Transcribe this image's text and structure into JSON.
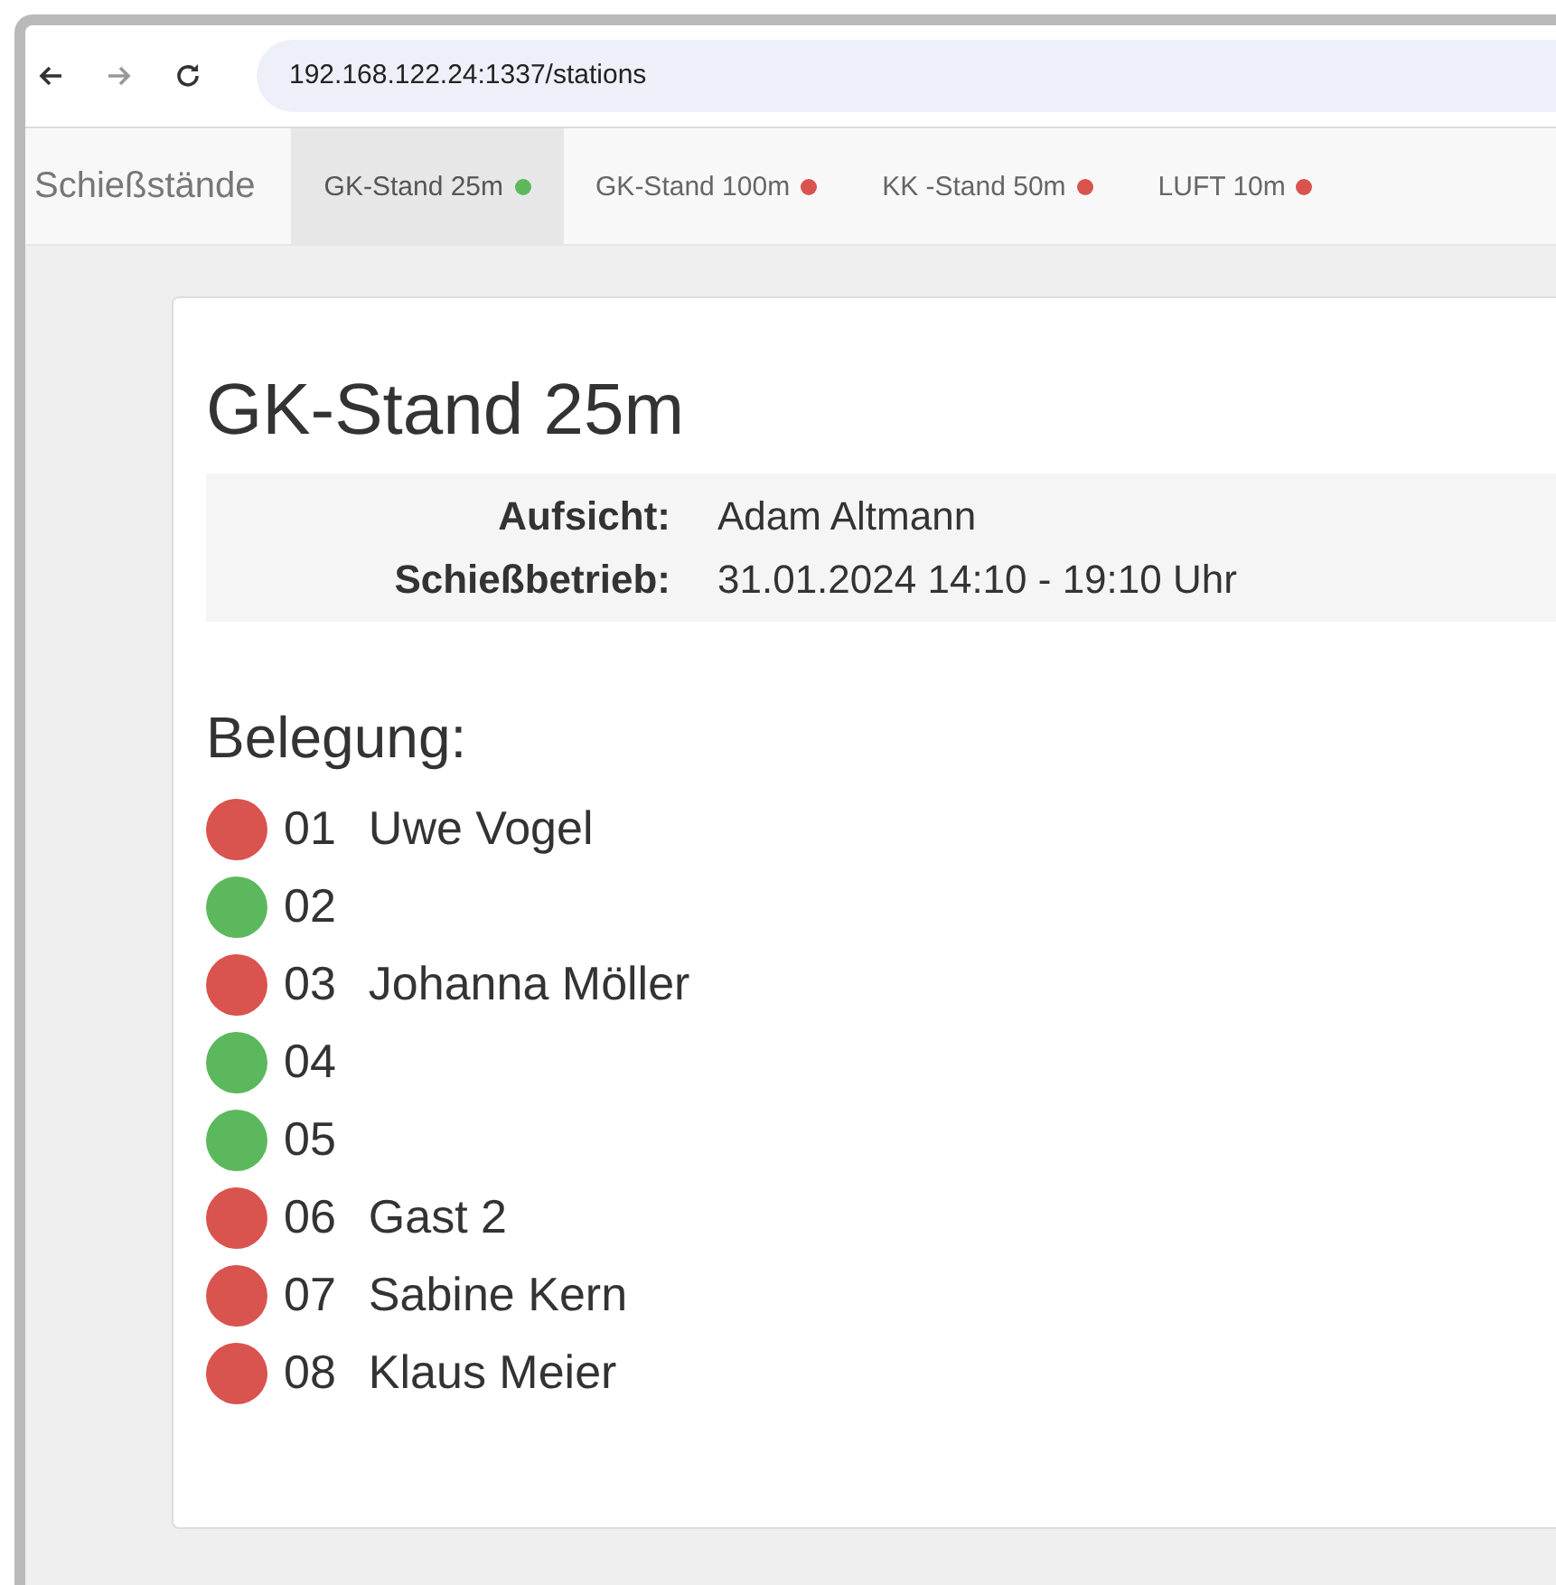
{
  "browser": {
    "url": "192.168.122.24:1337/stations"
  },
  "navbar": {
    "brand": "Schießstände",
    "tabs": [
      {
        "label": "GK-Stand 25m",
        "selected": true,
        "color": "#5cb85c"
      },
      {
        "label": "GK-Stand 100m",
        "selected": false,
        "color": "#d9534f"
      },
      {
        "label": "KK -Stand 50m",
        "selected": false,
        "color": "#d9534f"
      },
      {
        "label": "LUFT 10m",
        "selected": false,
        "color": "#d9534f"
      }
    ]
  },
  "station": {
    "title": "GK-Stand 25m",
    "info": [
      {
        "label": "Aufsicht:",
        "value": "Adam Altmann"
      },
      {
        "label": "Schießbetrieb:",
        "value": "31.01.2024 14:10 - 19:10 Uhr"
      }
    ],
    "occupancy_heading": "Belegung:",
    "lanes": [
      {
        "number": "01",
        "name": "Uwe Vogel",
        "color": "#d9534f"
      },
      {
        "number": "02",
        "color": "#5cb85c"
      },
      {
        "number": "03",
        "name": "Johanna Möller",
        "color": "#d9534f"
      },
      {
        "number": "04",
        "color": "#5cb85c"
      },
      {
        "number": "05",
        "color": "#5cb85c"
      },
      {
        "number": "06",
        "name": "Gast 2",
        "color": "#d9534f"
      },
      {
        "number": "07",
        "name": "Sabine Kern",
        "color": "#d9534f"
      },
      {
        "number": "08",
        "name": "Klaus Meier",
        "color": "#d9534f"
      }
    ]
  }
}
